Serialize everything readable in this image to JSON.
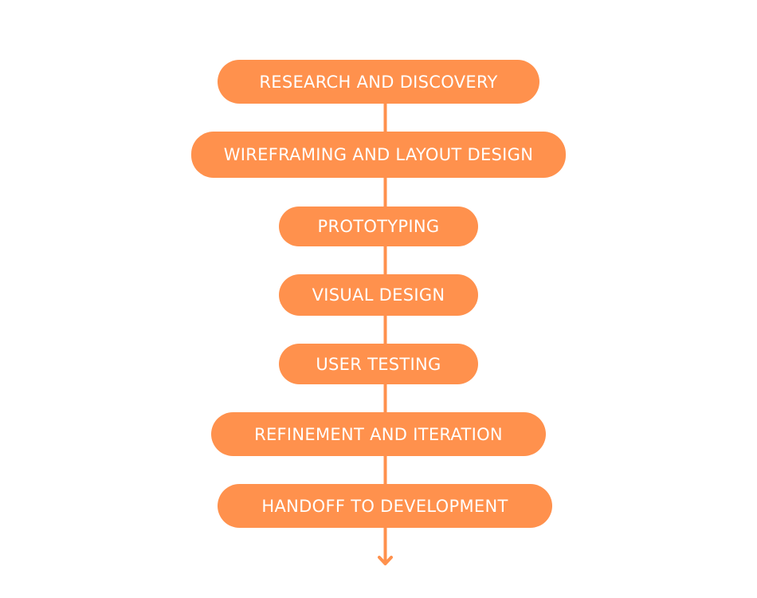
{
  "diagram": {
    "accent_color": "#FF914D",
    "steps": [
      {
        "label": "RESEARCH AND DISCOVERY"
      },
      {
        "label": "WIREFRAMING AND LAYOUT DESIGN"
      },
      {
        "label": "PROTOTYPING"
      },
      {
        "label": "VISUAL DESIGN"
      },
      {
        "label": "USER TESTING"
      },
      {
        "label": "REFINEMENT AND ITERATION"
      },
      {
        "label": "HANDOFF TO DEVELOPMENT"
      }
    ],
    "end_arrow": "arrow-down-icon"
  }
}
